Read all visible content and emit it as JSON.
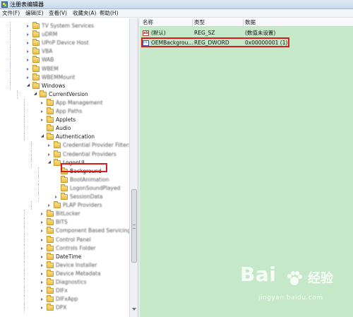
{
  "window": {
    "title": "注册表编辑器"
  },
  "menu": [
    "文件(F)",
    "编辑(E)",
    "查看(V)",
    "收藏夹(A)",
    "帮助(H)"
  ],
  "tree": {
    "items": [
      {
        "label": "TV System Services",
        "blurred": true,
        "state": "collapsed"
      },
      {
        "label": "uDRM",
        "blurred": true,
        "state": "collapsed"
      },
      {
        "label": "UPnP Device Host",
        "blurred": true,
        "state": "collapsed"
      },
      {
        "label": "VBA",
        "blurred": true,
        "state": "collapsed"
      },
      {
        "label": "WAB",
        "blurred": true,
        "state": "collapsed"
      },
      {
        "label": "WBEM",
        "blurred": true,
        "state": "collapsed"
      },
      {
        "label": "WBEMMount",
        "blurred": true,
        "state": "collapsed"
      },
      {
        "label": "Windows",
        "blurred": false,
        "state": "expanded"
      },
      {
        "label": "CurrentVersion",
        "blurred": false,
        "state": "expanded"
      },
      {
        "label": "App Management",
        "blurred": true,
        "state": "collapsed"
      },
      {
        "label": "App Paths",
        "blurred": true,
        "state": "collapsed"
      },
      {
        "label": "Applets",
        "blurred": false,
        "state": "collapsed"
      },
      {
        "label": "Audio",
        "blurred": false,
        "state": "none"
      },
      {
        "label": "Authentication",
        "blurred": false,
        "state": "expanded"
      },
      {
        "label": "Credential Provider Filters",
        "blurred": true,
        "state": "collapsed"
      },
      {
        "label": "Credential Providers",
        "blurred": true,
        "state": "collapsed"
      },
      {
        "label": "LogonUI",
        "blurred": false,
        "state": "expanded"
      },
      {
        "label": "Background",
        "blurred": false,
        "state": "none",
        "selected": true
      },
      {
        "label": "BootAnimation",
        "blurred": true,
        "state": "none"
      },
      {
        "label": "LogonSoundPlayed",
        "blurred": true,
        "state": "none"
      },
      {
        "label": "SessionData",
        "blurred": true,
        "state": "collapsed"
      },
      {
        "label": "PLAP Providers",
        "blurred": true,
        "state": "collapsed"
      },
      {
        "label": "BitLocker",
        "blurred": true,
        "state": "collapsed"
      },
      {
        "label": "BITS",
        "blurred": true,
        "state": "collapsed"
      },
      {
        "label": "Component Based Servicing",
        "blurred": true,
        "state": "collapsed"
      },
      {
        "label": "Control Panel",
        "blurred": true,
        "state": "collapsed"
      },
      {
        "label": "Controls Folder",
        "blurred": true,
        "state": "collapsed"
      },
      {
        "label": "DateTime",
        "blurred": false,
        "state": "collapsed"
      },
      {
        "label": "Device Installer",
        "blurred": true,
        "state": "collapsed"
      },
      {
        "label": "Device Metadata",
        "blurred": true,
        "state": "collapsed"
      },
      {
        "label": "Diagnostics",
        "blurred": true,
        "state": "collapsed"
      },
      {
        "label": "DIFx",
        "blurred": true,
        "state": "collapsed"
      },
      {
        "label": "DIFxApp",
        "blurred": true,
        "state": "collapsed"
      },
      {
        "label": "DPX",
        "blurred": true,
        "state": "collapsed"
      }
    ]
  },
  "list": {
    "headers": {
      "name": "名称",
      "type": "类型",
      "data": "数据"
    },
    "rows": [
      {
        "icon": "string-value-icon",
        "icon_text": "ab",
        "name": "(默认)",
        "type": "REG_SZ",
        "data": "(数值未设置)"
      },
      {
        "icon": "binary-value-icon",
        "icon_text": "011",
        "name": "OEMBackgrou...",
        "type": "REG_DWORD",
        "data": "0x00000001 (1)"
      }
    ]
  },
  "watermark": {
    "logo": "Bai",
    "logo2": "经验",
    "url": "jingyan.baidu.com"
  },
  "colors": {
    "list_background": "#c5e8c9",
    "highlight_box": "#e01a1a"
  }
}
